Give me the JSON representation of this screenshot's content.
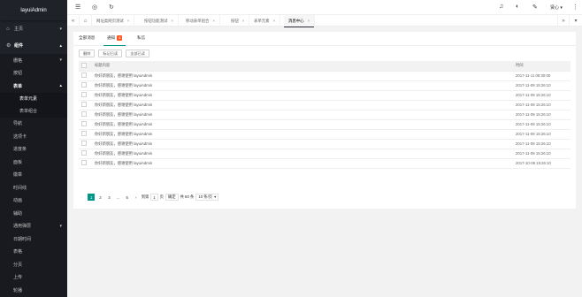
{
  "app": {
    "title": "layuiAdmin"
  },
  "sidebar": {
    "items": [
      {
        "label": "主页",
        "icon": "home-icon"
      },
      {
        "label": "组件",
        "icon": "component-icon"
      }
    ],
    "sub": [
      {
        "label": "栅格"
      },
      {
        "label": "按钮"
      },
      {
        "label": "表单"
      }
    ],
    "sub2": [
      {
        "label": "表单元素"
      },
      {
        "label": "表单组合"
      }
    ],
    "rest": [
      {
        "label": "导航"
      },
      {
        "label": "选项卡"
      },
      {
        "label": "进度条"
      },
      {
        "label": "面板"
      },
      {
        "label": "徽章"
      },
      {
        "label": "时间线"
      },
      {
        "label": "动画"
      },
      {
        "label": "辅助"
      },
      {
        "label": "通用弹层"
      },
      {
        "label": "日期时间"
      },
      {
        "label": "表格"
      },
      {
        "label": "分页"
      },
      {
        "label": "上传"
      },
      {
        "label": "轮播"
      }
    ]
  },
  "header": {
    "user": "贤心"
  },
  "tabs": [
    {
      "label": "网址类网页测试"
    },
    {
      "label": "按钮功能测试"
    },
    {
      "label": "移动表单组合"
    },
    {
      "label": "按钮"
    },
    {
      "label": "表单元素"
    },
    {
      "label": "消息中心"
    }
  ],
  "content": {
    "tabs": [
      {
        "label": "全部消息"
      },
      {
        "label": "通知",
        "badge": "6"
      },
      {
        "label": "私信"
      }
    ],
    "toolbar": {
      "delete": "删除",
      "mark_read": "标记已读",
      "all_read": "全部已读"
    },
    "table": {
      "headers": {
        "title": "标题内容",
        "time": "时间"
      },
      "rows": [
        {
          "title": "你好新朋友，感谢使用 layuiAdmin",
          "time": "2017-11-11 09:30:00"
        },
        {
          "title": "你好新朋友，感谢使用 layuiAdmin",
          "time": "2017-11-09 15:26:10"
        },
        {
          "title": "你好新朋友，感谢使用 layuiAdmin",
          "time": "2017-11-09 15:26:10"
        },
        {
          "title": "你好新朋友，感谢使用 layuiAdmin",
          "time": "2017-11-09 15:26:10"
        },
        {
          "title": "你好新朋友，感谢使用 layuiAdmin",
          "time": "2017-11-09 15:26:10"
        },
        {
          "title": "你好新朋友，感谢使用 layuiAdmin",
          "time": "2017-11-09 15:26:10"
        },
        {
          "title": "你好新朋友，感谢使用 layuiAdmin",
          "time": "2017-11-09 15:26:10"
        },
        {
          "title": "你好新朋友，感谢使用 layuiAdmin",
          "time": "2017-11-09 15:26:10"
        },
        {
          "title": "你好新朋友，感谢使用 layuiAdmin",
          "time": "2017-11-09 15:26:10"
        },
        {
          "title": "你好新朋友，感谢使用 layuiAdmin",
          "time": "2017-10-08 15:26:10"
        }
      ]
    },
    "pager": {
      "pages": [
        "1",
        "2",
        "3",
        "…",
        "6"
      ],
      "goto": "到第",
      "page_input": "1",
      "page_unit": "页",
      "confirm": "确定",
      "total": "共 60 条",
      "per_page": "10 条/页"
    }
  },
  "colors": {
    "sidebar_bg": "#20222a",
    "accent": "#009688",
    "badge": "#ff5722"
  }
}
